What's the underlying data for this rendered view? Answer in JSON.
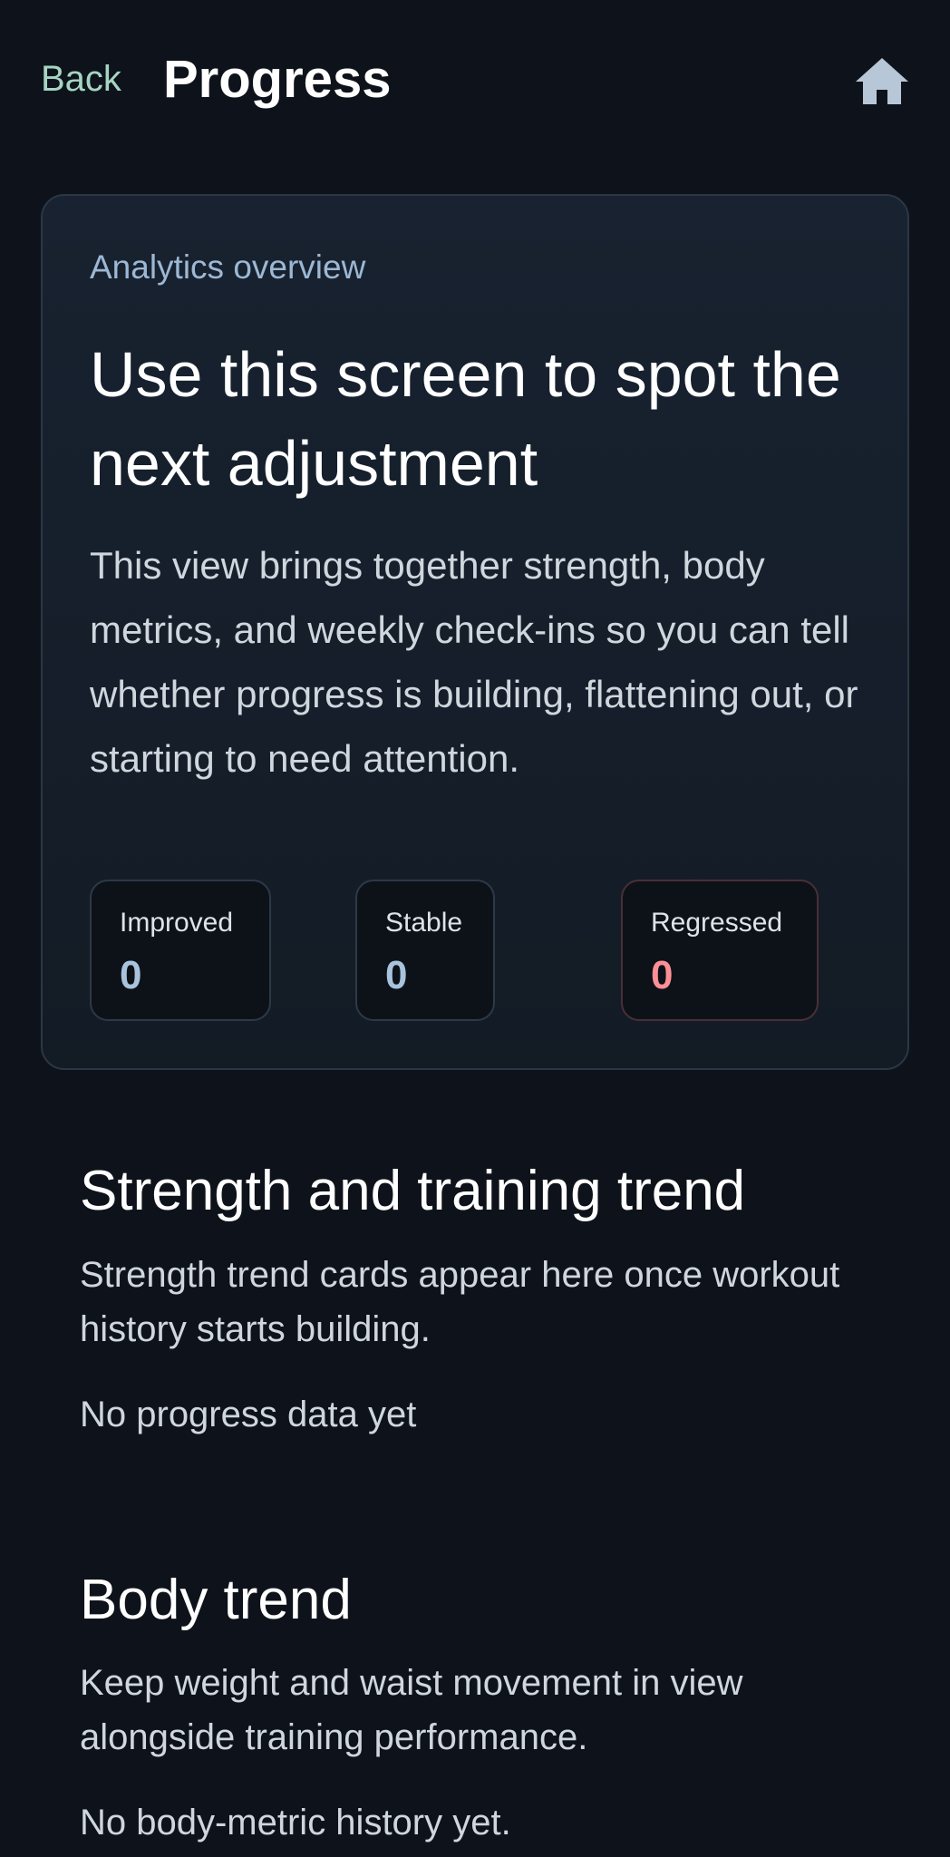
{
  "header": {
    "back_label": "Back",
    "title": "Progress",
    "home_icon": "home-icon"
  },
  "overview": {
    "eyebrow": "Analytics overview",
    "heading": "Use this screen to spot the next adjustment",
    "description": "This view brings together strength, body metrics, and weekly check-ins so you can tell whether progress is building, flattening out, or starting to need attention.",
    "stats": [
      {
        "label": "Improved",
        "value": "0"
      },
      {
        "label": "Stable",
        "value": "0"
      },
      {
        "label": "Regressed",
        "value": "0"
      }
    ]
  },
  "sections": {
    "strength": {
      "title": "Strength and training trend",
      "description": "Strength trend cards appear here once workout history starts building.",
      "empty_text": "No progress data yet"
    },
    "body": {
      "title": "Body trend",
      "description": "Keep weight and waist movement in view alongside training performance.",
      "empty_text": "No body-metric history yet."
    }
  },
  "colors": {
    "background": "#0e131b",
    "back_link": "#a6d4c3",
    "eyebrow": "#9cb8d4",
    "stat_value": "#a9c3dd",
    "regressed_value": "#ff8f96"
  }
}
